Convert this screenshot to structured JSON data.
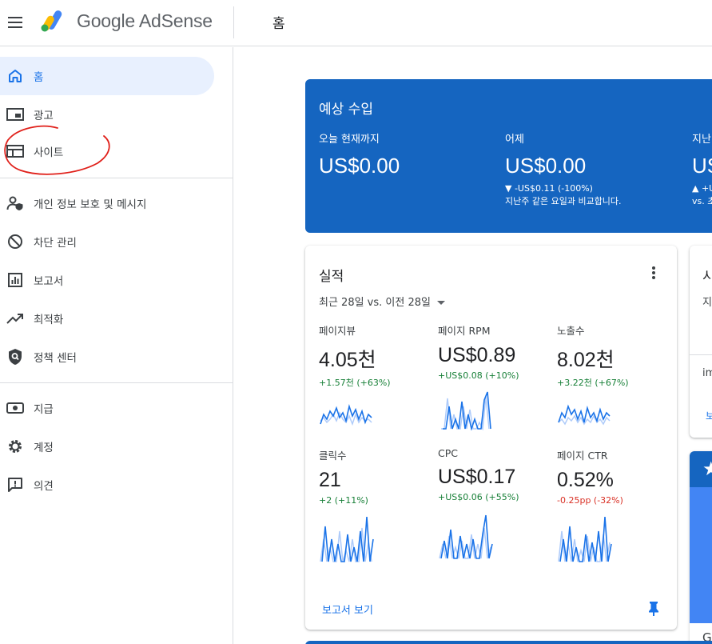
{
  "app": {
    "name": "Google AdSense",
    "page_title": "홈"
  },
  "sidebar": {
    "items": [
      {
        "label": "홈",
        "icon": "home-icon",
        "active": true
      },
      {
        "label": "광고",
        "icon": "ads-icon"
      },
      {
        "label": "사이트",
        "icon": "sites-icon"
      },
      {
        "label": "개인 정보 보호 및 메시지",
        "icon": "privacy-icon"
      },
      {
        "label": "차단 관리",
        "icon": "block-icon"
      },
      {
        "label": "보고서",
        "icon": "reports-icon"
      },
      {
        "label": "최적화",
        "icon": "optimization-icon"
      },
      {
        "label": "정책 센터",
        "icon": "policy-icon"
      },
      {
        "label": "지급",
        "icon": "payments-icon"
      },
      {
        "label": "계정",
        "icon": "gear-icon"
      },
      {
        "label": "의견",
        "icon": "feedback-icon"
      }
    ]
  },
  "earnings": {
    "title": "예상 수입",
    "columns": [
      {
        "label": "오늘 현재까지",
        "value": "US$0.00",
        "delta": "",
        "compare": ""
      },
      {
        "label": "어제",
        "value": "US$0.00",
        "delta": "▼ -US$0.11 (-100%)",
        "compare": "지난주 같은 요일과 비교합니다."
      },
      {
        "label": "지난",
        "value": "US",
        "delta": "▲ +U",
        "compare": "vs. 초"
      }
    ]
  },
  "performance": {
    "title": "실적",
    "range": "최근 28일 vs. 이전 28일",
    "metrics": [
      {
        "label": "페이지뷰",
        "value": "4.05천",
        "delta": "+1.57천 (+63%)",
        "trend": "pos"
      },
      {
        "label": "페이지 RPM",
        "value": "US$0.89",
        "delta": "+US$0.08 (+10%)",
        "trend": "pos"
      },
      {
        "label": "노출수",
        "value": "8.02천",
        "delta": "+3.22천 (+67%)",
        "trend": "pos"
      },
      {
        "label": "클릭수",
        "value": "21",
        "delta": "+2 (+11%)",
        "trend": "pos"
      },
      {
        "label": "CPC",
        "value": "US$0.17",
        "delta": "+US$0.06 (+55%)",
        "trend": "pos"
      },
      {
        "label": "페이지 CTR",
        "value": "0.52%",
        "delta": "-0.25pp (-32%)",
        "trend": "neg"
      }
    ],
    "report_link": "보고서 보기"
  },
  "side_card": {
    "title": "시",
    "subtitle": "지",
    "item": "im",
    "link": "보"
  },
  "blue_card": {
    "text": "G"
  },
  "colors": {
    "brand_blue": "#1565c0",
    "link_blue": "#1a73e8",
    "positive": "#188038",
    "negative": "#d93025"
  }
}
